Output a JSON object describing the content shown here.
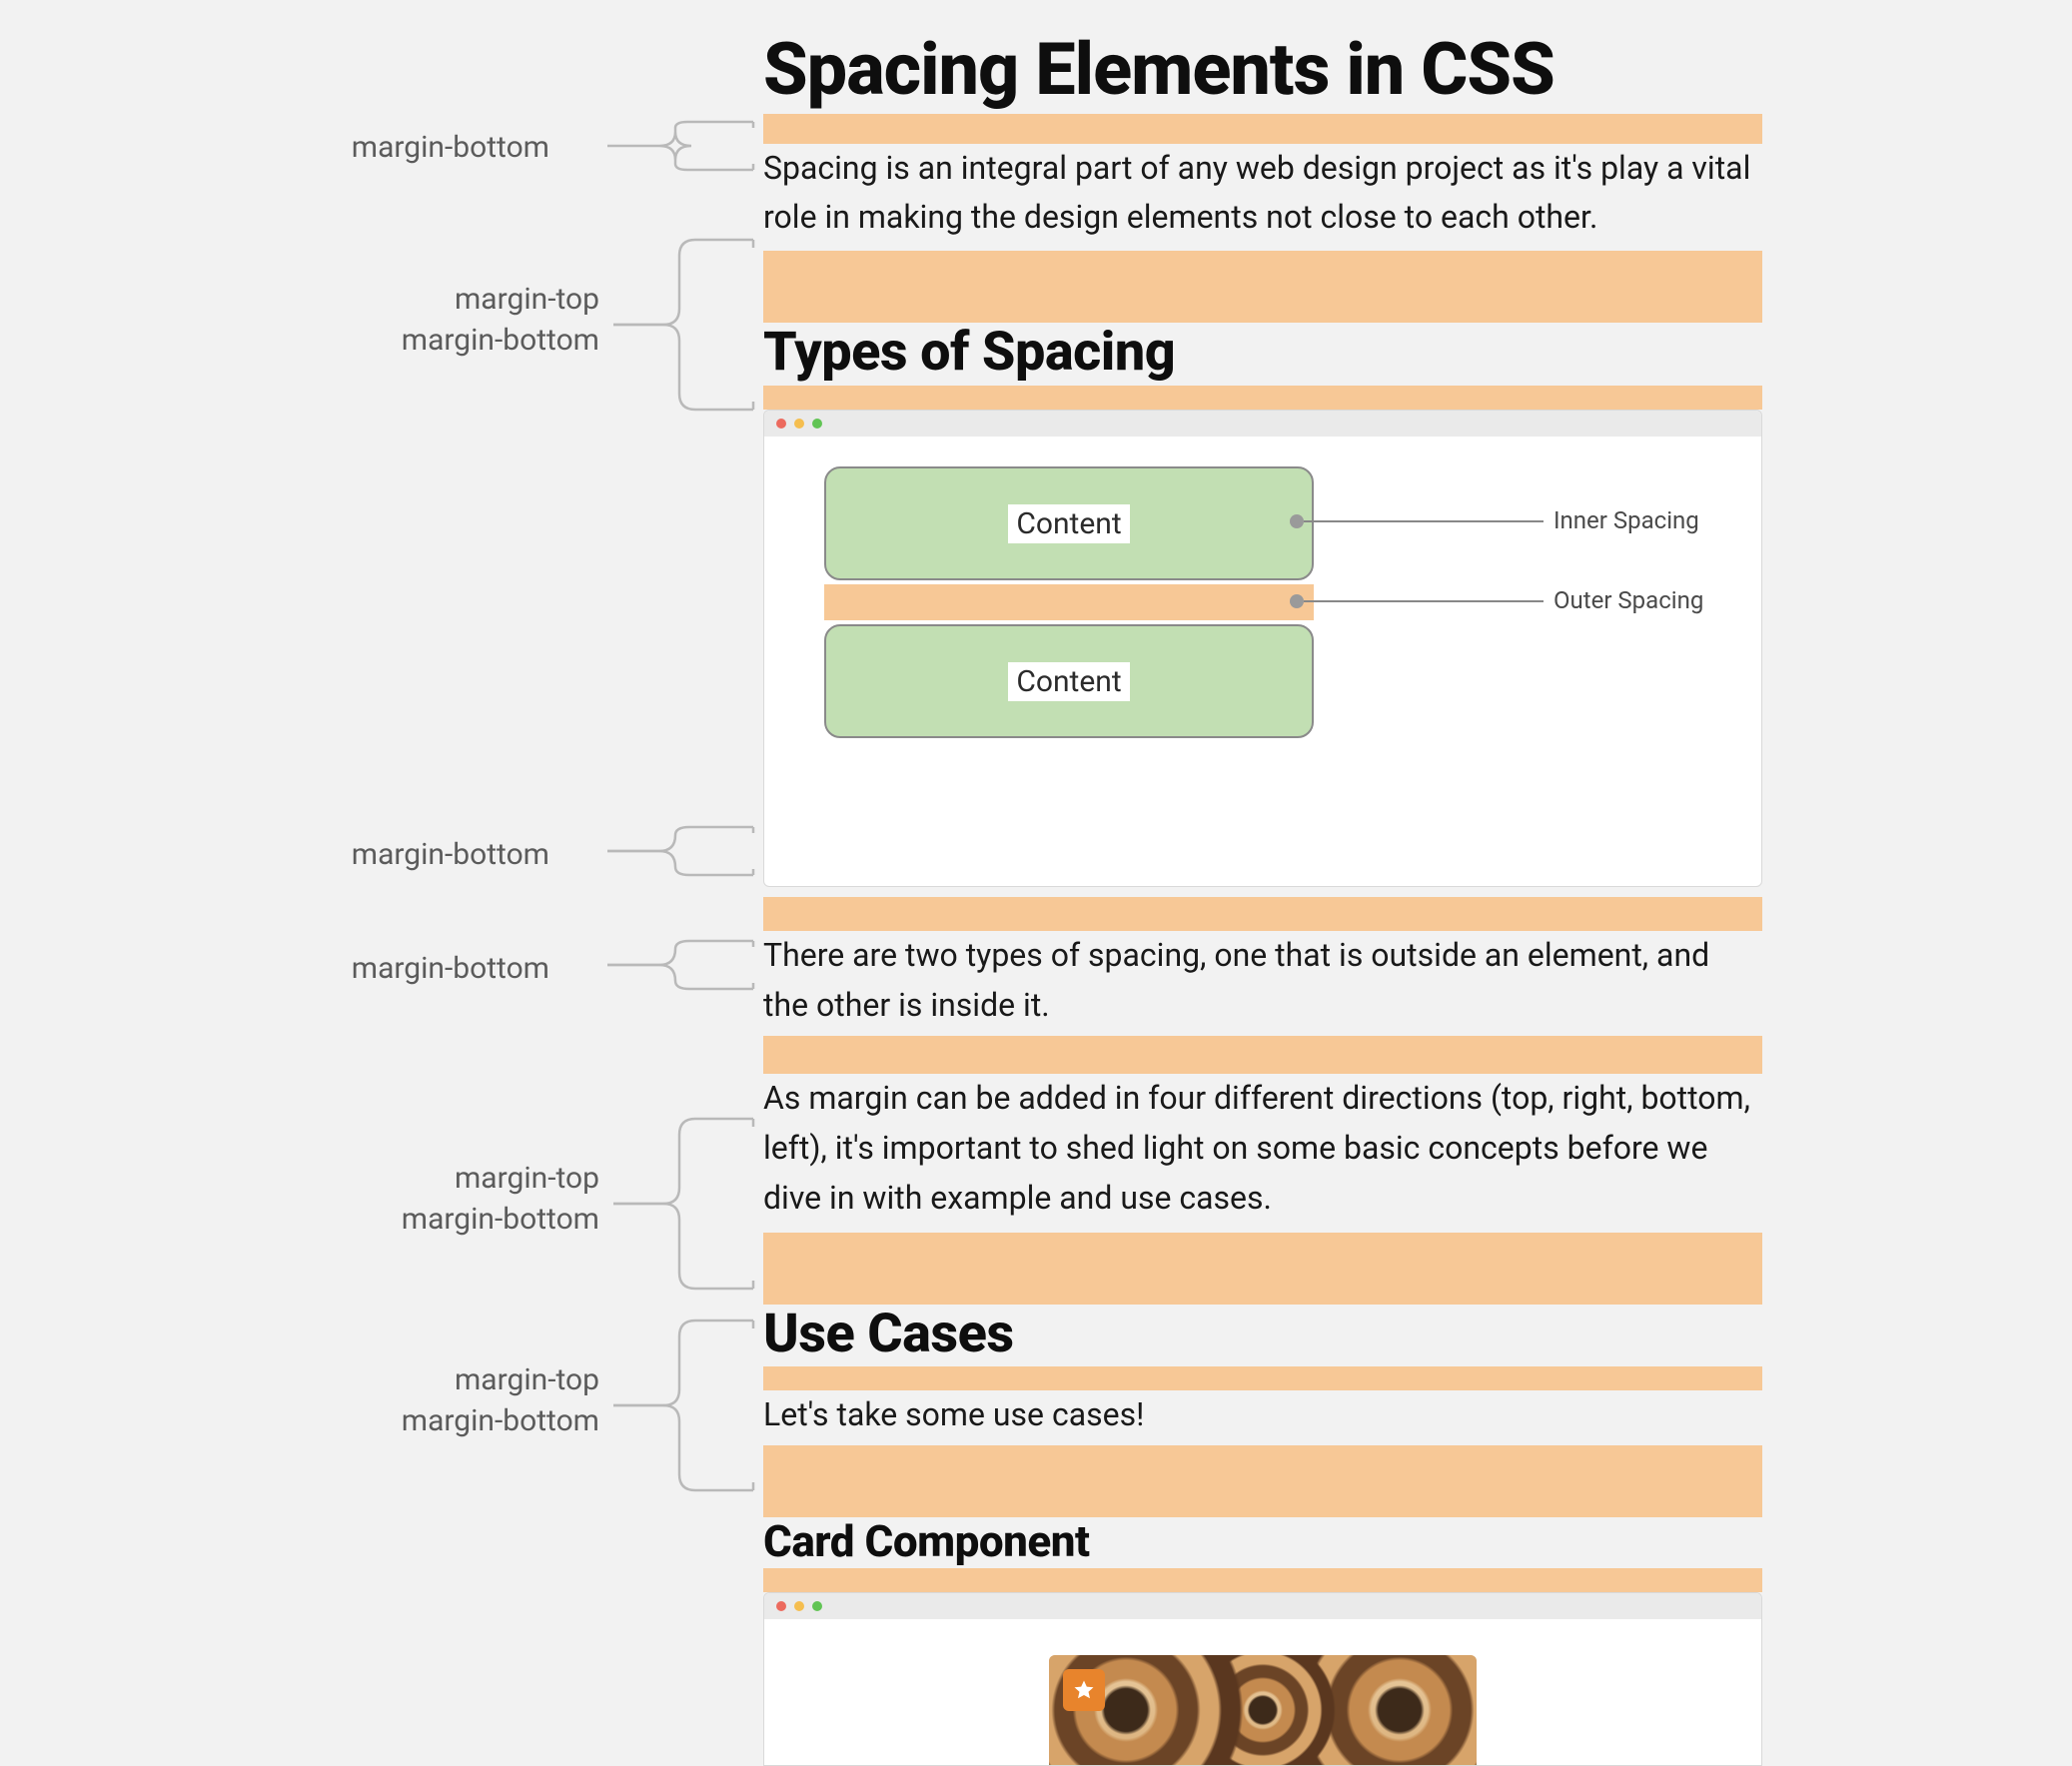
{
  "annotations": {
    "a1": "margin-bottom",
    "a2_l1": "margin-top",
    "a2_l2": "margin-bottom",
    "a3": "margin-bottom",
    "a4": "margin-bottom",
    "a5_l1": "margin-top",
    "a5_l2": "margin-bottom",
    "a6_l1": "margin-top",
    "a6_l2": "margin-bottom"
  },
  "article": {
    "h1": "Spacing Elements in CSS",
    "p1": "Spacing is an integral part of any web design project as it's play a vital role in making the design elements not close to each other.",
    "h2_types": "Types of Spacing",
    "p2": "There are two types of spacing, one that is outside an element, and the other is inside it.",
    "p3": "As margin can be added in four different directions (top, right, bottom, left), it's important to shed light on some basic concepts before we dive in with example and use cases.",
    "h2_uc": "Use Cases",
    "p4": "Let's take some use cases!",
    "h3_card": "Card Component"
  },
  "fig1": {
    "box_label": "Content",
    "inner_label": "Inner Spacing",
    "outer_label": "Outer Spacing"
  }
}
